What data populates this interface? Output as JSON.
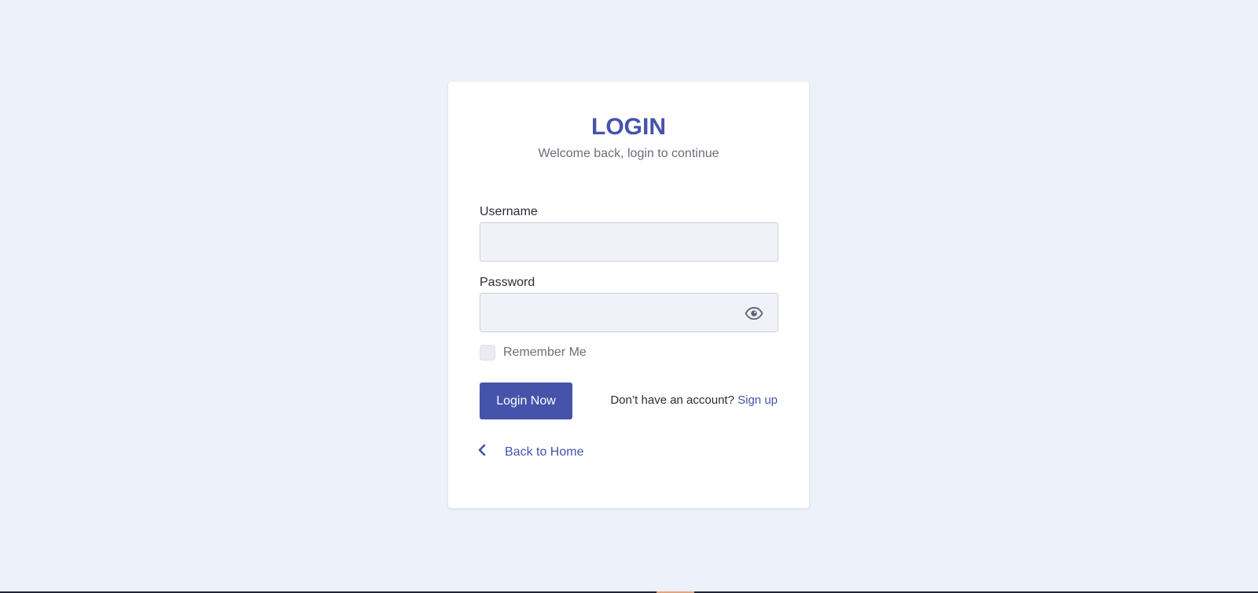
{
  "login": {
    "title": "LOGIN",
    "subtitle": "Welcome back, login to continue",
    "username": {
      "label": "Username",
      "value": "",
      "placeholder": ""
    },
    "password": {
      "label": "Password",
      "value": "",
      "placeholder": "",
      "toggle_icon": "eye-icon"
    },
    "remember_me": {
      "label": "Remember Me",
      "checked": false
    },
    "submit_label": "Login Now",
    "signup_prompt": "Don’t have an account?",
    "signup_link": "Sign up",
    "back_icon": "chevron-left-icon",
    "back_label": "Back to Home"
  },
  "colors": {
    "background": "#edf1f9",
    "card": "#ffffff",
    "accent": "#4653ab",
    "input_background": "#f1f2f7",
    "muted_text": "#6b6e7a"
  }
}
